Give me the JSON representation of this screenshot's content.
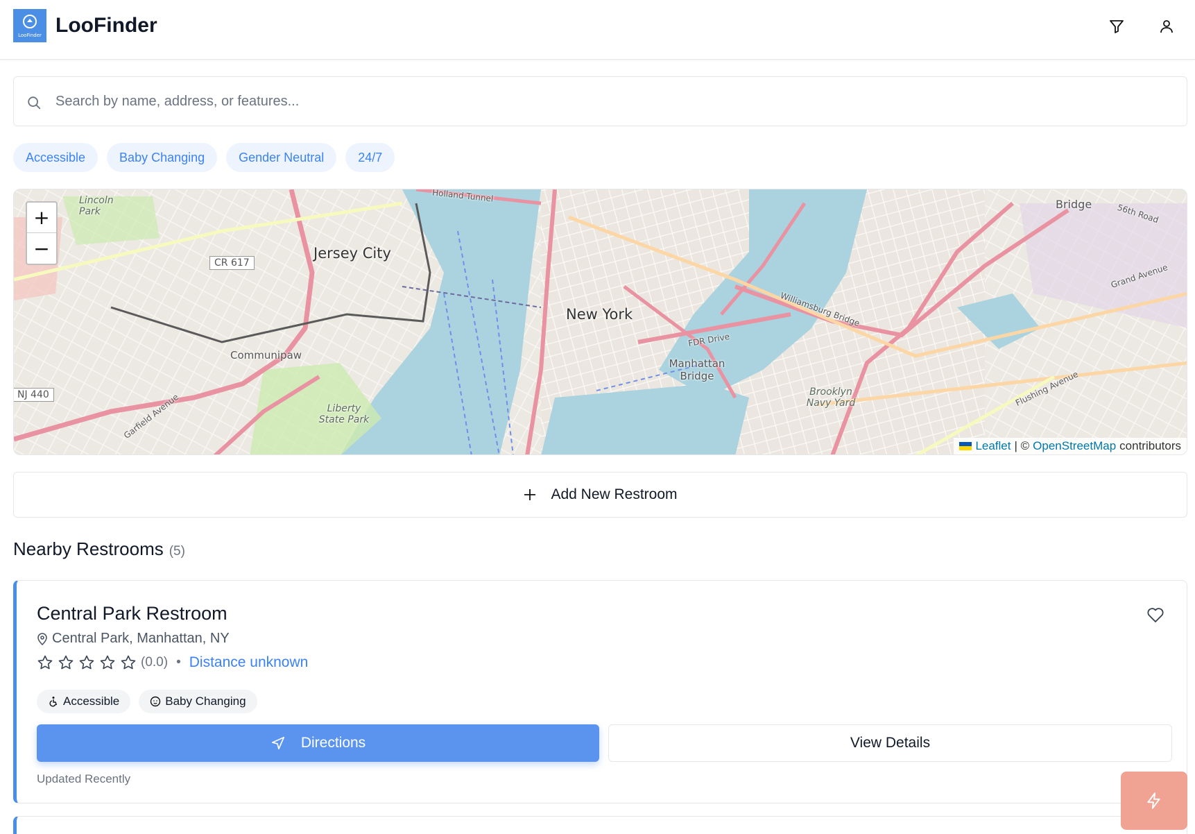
{
  "app": {
    "title": "LooFinder",
    "logo_text": "LooFinder"
  },
  "header": {
    "filter_icon": "filter-icon",
    "user_icon": "user-icon"
  },
  "search": {
    "placeholder": "Search by name, address, or features..."
  },
  "filters": [
    "Accessible",
    "Baby Changing",
    "Gender Neutral",
    "24/7"
  ],
  "map": {
    "zoom_in": "+",
    "zoom_out": "−",
    "labels": [
      "Jersey City",
      "New York",
      "Manhattan Bridge",
      "Communipaw",
      "Liberty State Park",
      "Brooklyn Navy Yard",
      "Lincoln Park",
      "CR 617",
      "NJ 440",
      "Williamsburg Bridge",
      "Holland Tunnel",
      "FDR Drive",
      "Grand Avenue",
      "Flushing Avenue",
      "Garfield Avenue",
      "Bridge",
      "56th Road"
    ],
    "attribution": {
      "leaflet": "Leaflet",
      "sep": "| ©",
      "osm": "OpenStreetMap",
      "suffix": "contributors"
    }
  },
  "add_button": {
    "label": "Add New Restroom"
  },
  "section": {
    "title": "Nearby Restrooms",
    "count": "(5)"
  },
  "restrooms": [
    {
      "name": "Central Park Restroom",
      "address": "Central Park, Manhattan, NY",
      "rating": 0,
      "rating_text": "(0.0)",
      "distance": "Distance unknown",
      "tags": [
        "Accessible",
        "Baby Changing"
      ],
      "directions_label": "Directions",
      "details_label": "View Details",
      "updated": "Updated Recently"
    }
  ],
  "colors": {
    "accent": "#4b8ee6",
    "button": "#5a94ee",
    "chip_bg": "#eef4fd",
    "fab": "#f0a393"
  }
}
